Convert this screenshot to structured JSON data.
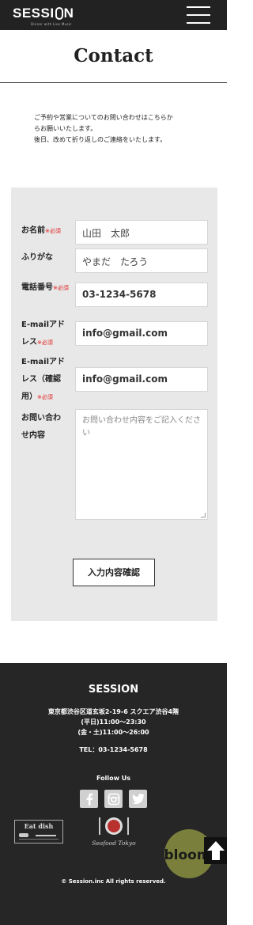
{
  "header": {
    "logo_left": "SESSI",
    "logo_right": "N",
    "logo_tagline": "Dinner with Live Music",
    "menu_icon": "hamburger-menu-icon"
  },
  "page": {
    "title": "Contact",
    "intro": [
      "ご予約や営業についてのお問い合わせはこちらか",
      "らお願いいたします。",
      "後日、改めて折り返しのご連絡をいたします。"
    ]
  },
  "form": {
    "required_mark": "※必須",
    "fields": {
      "name": {
        "label": "お名前",
        "value": "山田　太郎"
      },
      "furigana": {
        "label": "ふりがな",
        "value": "やまだ　たろう"
      },
      "phone": {
        "label": "電話番号",
        "value": "03-1234-5678"
      },
      "email": {
        "label_1": "E-mailアド",
        "label_2": "レス",
        "value": "info@gmail.com"
      },
      "email_confirm": {
        "label_1": "E-mailアド",
        "label_2": "レス（確認",
        "label_3": "用）",
        "value": "info@gmail.com"
      },
      "message": {
        "label_1": "お問い合わ",
        "label_2": "せ内容",
        "placeholder": "お問い合わせ内容をご記入ください"
      }
    },
    "confirm_button": "入力内容確認"
  },
  "footer": {
    "brand": "SESSION",
    "address": "東京都渋谷区道玄坂2-19-6 スクエア渋谷4階",
    "hours_weekday": "(平日)11:00〜23:30",
    "hours_weekend": "(金・土)11:00〜26:00",
    "tel": "TEL：03-1234-5678",
    "follow_us": "Follow Us",
    "social": [
      "facebook-icon",
      "instagram-icon",
      "twitter-icon"
    ],
    "partners": {
      "eat_dish": "Eat dish",
      "seafood": "Seafood Tokyo",
      "bloom": "bloom"
    },
    "copyright": "© Session.inc All rights reserved.",
    "accent_bloom": "#7a7f3c"
  }
}
